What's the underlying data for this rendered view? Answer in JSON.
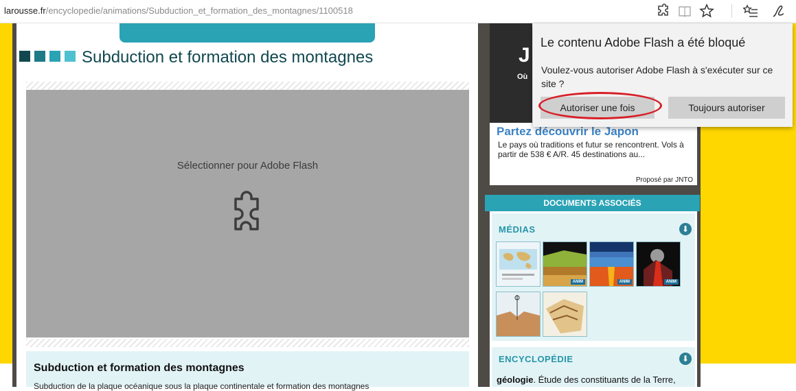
{
  "browser": {
    "url_host": "larousse.fr",
    "url_path": "/encyclopedie/animations/Subduction_et_formation_des_montagnes/1100518",
    "icons": [
      "puzzle-icon",
      "reading-view-icon",
      "favorite-star-icon",
      "hub-icon",
      "web-note-pen-icon"
    ]
  },
  "article": {
    "title": "Subduction et formation des montagnes",
    "flash_placeholder": "Sélectionner pour Adobe Flash",
    "summary_title": "Subduction et formation des montagnes",
    "summary_text": "Subduction de la plaque océanique sous la plaque continentale et formation des montagnes"
  },
  "ad": {
    "image_glyph": "J",
    "image_glyph2": "Où",
    "title": "Partez découvrir le Japon",
    "text": "Le pays où traditions et futur se rencontrent. Vols à partir de 538 € A/R. 45 destinations au...",
    "credit": "Proposé par JNTO"
  },
  "documents": {
    "header": "DOCUMENTS ASSOCIÉS",
    "medias_label": "MÉDIAS",
    "anim_badge": "ANIM",
    "encyclo_label": "ENCYCLOPÉDIE",
    "encyclo_term": "géologie",
    "encyclo_text": ". Étude des constituants de la Terre,"
  },
  "flash_popup": {
    "title": "Le contenu Adobe Flash a été bloqué",
    "message": "Voulez-vous autoriser Adobe Flash à s'exécuter sur ce site ?",
    "allow_once": "Autoriser une fois",
    "allow_always": "Toujours autoriser"
  },
  "colors": {
    "accent_teal": "#2aa3b5",
    "page_yellow": "#fed700",
    "annotation_red": "#d81f26"
  }
}
